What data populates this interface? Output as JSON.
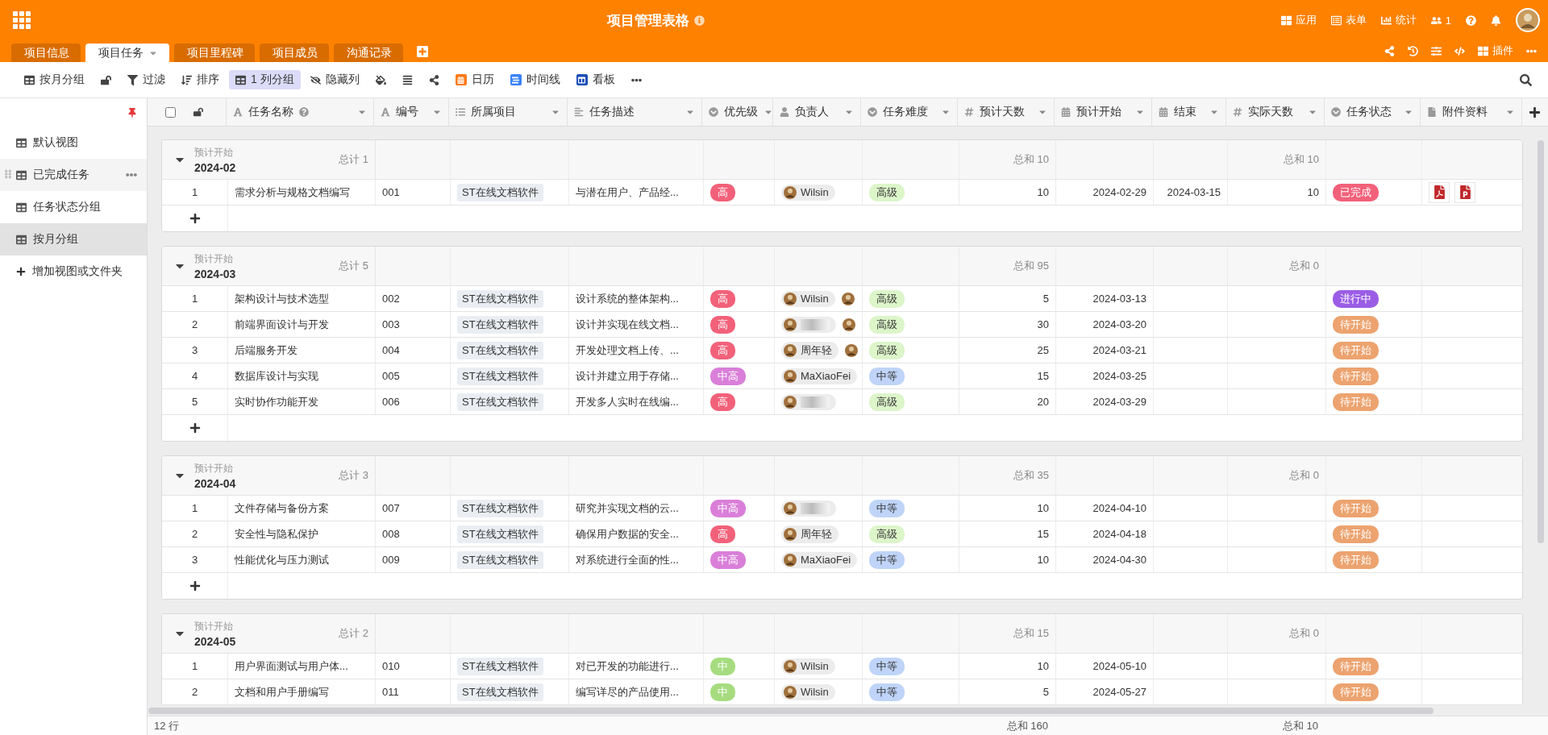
{
  "app": {
    "title": "项目管理表格"
  },
  "top_actions": [
    {
      "kind": "apps",
      "label": "应用"
    },
    {
      "kind": "form",
      "label": "表单"
    },
    {
      "kind": "stats",
      "label": "统计"
    },
    {
      "kind": "collaborators",
      "label": "1"
    },
    {
      "kind": "help"
    },
    {
      "kind": "notifications"
    },
    {
      "kind": "avatar"
    }
  ],
  "tabs": [
    {
      "label": "项目信息",
      "selected": false
    },
    {
      "label": "项目任务",
      "selected": true
    },
    {
      "label": "项目里程碑",
      "selected": false
    },
    {
      "label": "项目成员",
      "selected": false
    },
    {
      "label": "沟通记录",
      "selected": false
    }
  ],
  "tab_actions": [
    {
      "kind": "share"
    },
    {
      "kind": "history"
    },
    {
      "kind": "settings"
    },
    {
      "kind": "code"
    },
    {
      "kind": "plugins",
      "label": "插件"
    },
    {
      "kind": "more"
    }
  ],
  "toolbar": [
    {
      "kind": "view",
      "label": "按月分组",
      "active": false
    },
    {
      "kind": "lock",
      "active": false
    },
    {
      "kind": "filter",
      "label": "过滤",
      "active": false
    },
    {
      "kind": "sort",
      "label": "排序",
      "active": false
    },
    {
      "kind": "group",
      "label": "1 列分组",
      "active": true
    },
    {
      "kind": "hide",
      "label": "隐藏列",
      "active": false
    },
    {
      "kind": "fill",
      "active": false
    },
    {
      "kind": "row-height",
      "active": false
    },
    {
      "kind": "share",
      "active": false
    },
    {
      "kind": "calendar",
      "label": "日历",
      "active": false
    },
    {
      "kind": "timeline",
      "label": "时间线",
      "active": false
    },
    {
      "kind": "kanban",
      "label": "看板",
      "active": false
    },
    {
      "kind": "more",
      "active": false
    }
  ],
  "sidebar": {
    "items": [
      {
        "label": "默认视图",
        "selected": false,
        "hovered": false
      },
      {
        "label": "已完成任务",
        "selected": false,
        "hovered": true
      },
      {
        "label": "任务状态分组",
        "selected": false,
        "hovered": false
      },
      {
        "label": "按月分组",
        "selected": true,
        "hovered": false
      }
    ],
    "add_label": "增加视图或文件夹"
  },
  "table": {
    "select_all": {
      "checked": false
    },
    "columns": [
      {
        "label": "任务名称",
        "kind": "text",
        "help": true
      },
      {
        "label": "编号",
        "kind": "text",
        "help": false
      },
      {
        "label": "所属项目",
        "kind": "link",
        "help": false
      },
      {
        "label": "任务描述",
        "kind": "long-text",
        "help": false
      },
      {
        "label": "优先级",
        "kind": "single-select",
        "help": false
      },
      {
        "label": "负责人",
        "kind": "collaborator",
        "help": false
      },
      {
        "label": "任务难度",
        "kind": "single-select",
        "help": false
      },
      {
        "label": "预计天数",
        "kind": "number",
        "help": false
      },
      {
        "label": "预计开始",
        "kind": "date",
        "help": false
      },
      {
        "label": "结束",
        "kind": "date",
        "help": false
      },
      {
        "label": "实际天数",
        "kind": "number",
        "help": false
      },
      {
        "label": "任务状态",
        "kind": "single-select",
        "help": false
      },
      {
        "label": "附件资料",
        "kind": "file",
        "help": false
      }
    ],
    "groups": [
      {
        "field_label": "预计开始",
        "value": "2024-02",
        "count": "总计 1",
        "planned_days_sum": "总和 10",
        "actual_days_sum": "总和 10",
        "expanded": true,
        "rows": [
          {
            "num": "1",
            "name": "需求分析与规格文档编写",
            "code": "001",
            "project": "ST在线文档软件",
            "description": "与潜在用户、产品经...",
            "priority": {
              "label": "高",
              "color": "#f2617a"
            },
            "owners": [
              {
                "kind": "person",
                "name": "Wilsin"
              }
            ],
            "difficulty": {
              "label": "高级",
              "color": "#dcf5c9"
            },
            "planned_days": "10",
            "start": "2024-02-29",
            "end": "2024-03-15",
            "actual_days": "10",
            "status": {
              "label": "已完成",
              "color": "#f2617a"
            },
            "attachments": [
              {
                "kind": "pdf"
              },
              {
                "kind": "ppt"
              }
            ]
          }
        ]
      },
      {
        "field_label": "预计开始",
        "value": "2024-03",
        "count": "总计 5",
        "planned_days_sum": "总和 95",
        "actual_days_sum": "总和 0",
        "expanded": true,
        "rows": [
          {
            "num": "1",
            "name": "架构设计与技术选型",
            "code": "002",
            "project": "ST在线文档软件",
            "description": "设计系统的整体架构...",
            "priority": {
              "label": "高",
              "color": "#f2617a"
            },
            "owners": [
              {
                "kind": "person",
                "name": "Wilsin"
              },
              {
                "kind": "avatar"
              }
            ],
            "difficulty": {
              "label": "高级",
              "color": "#dcf5c9"
            },
            "planned_days": "5",
            "start": "2024-03-13",
            "status": {
              "label": "进行中",
              "color": "#9b5de5"
            }
          },
          {
            "num": "2",
            "name": "前端界面设计与开发",
            "code": "003",
            "project": "ST在线文档软件",
            "description": "设计并实现在线文档...",
            "priority": {
              "label": "高",
              "color": "#f2617a"
            },
            "owners": [
              {
                "kind": "masked"
              },
              {
                "kind": "avatar"
              }
            ],
            "difficulty": {
              "label": "高级",
              "color": "#dcf5c9"
            },
            "planned_days": "30",
            "start": "2024-03-20",
            "status": {
              "label": "待开始",
              "color": "#eca36f"
            }
          },
          {
            "num": "3",
            "name": "后端服务开发",
            "code": "004",
            "project": "ST在线文档软件",
            "description": "开发处理文档上传、...",
            "priority": {
              "label": "高",
              "color": "#f2617a"
            },
            "owners": [
              {
                "kind": "person",
                "name": "周年轻"
              },
              {
                "kind": "avatar"
              }
            ],
            "difficulty": {
              "label": "高级",
              "color": "#dcf5c9"
            },
            "planned_days": "25",
            "start": "2024-03-21",
            "status": {
              "label": "待开始",
              "color": "#eca36f"
            }
          },
          {
            "num": "4",
            "name": "数据库设计与实现",
            "code": "005",
            "project": "ST在线文档软件",
            "description": "设计并建立用于存储...",
            "priority": {
              "label": "中高",
              "color": "#da7fd9"
            },
            "owners": [
              {
                "kind": "person",
                "name": "MaXiaoFei"
              }
            ],
            "difficulty": {
              "label": "中等",
              "color": "#bfd4f8"
            },
            "planned_days": "15",
            "start": "2024-03-25",
            "status": {
              "label": "待开始",
              "color": "#eca36f"
            }
          },
          {
            "num": "5",
            "name": "实时协作功能开发",
            "code": "006",
            "project": "ST在线文档软件",
            "description": "开发多人实时在线编...",
            "priority": {
              "label": "高",
              "color": "#f2617a"
            },
            "owners": [
              {
                "kind": "masked"
              }
            ],
            "difficulty": {
              "label": "高级",
              "color": "#dcf5c9"
            },
            "planned_days": "20",
            "start": "2024-03-29",
            "status": {
              "label": "待开始",
              "color": "#eca36f"
            }
          }
        ]
      },
      {
        "field_label": "预计开始",
        "value": "2024-04",
        "count": "总计 3",
        "planned_days_sum": "总和 35",
        "actual_days_sum": "总和 0",
        "expanded": true,
        "rows": [
          {
            "num": "1",
            "name": "文件存储与备份方案",
            "code": "007",
            "project": "ST在线文档软件",
            "description": "研究并实现文档的云...",
            "priority": {
              "label": "中高",
              "color": "#da7fd9"
            },
            "owners": [
              {
                "kind": "masked"
              }
            ],
            "difficulty": {
              "label": "中等",
              "color": "#bfd4f8"
            },
            "planned_days": "10",
            "start": "2024-04-10",
            "status": {
              "label": "待开始",
              "color": "#eca36f"
            }
          },
          {
            "num": "2",
            "name": "安全性与隐私保护",
            "code": "008",
            "project": "ST在线文档软件",
            "description": "确保用户数据的安全...",
            "priority": {
              "label": "高",
              "color": "#f2617a"
            },
            "owners": [
              {
                "kind": "person",
                "name": "周年轻"
              }
            ],
            "difficulty": {
              "label": "高级",
              "color": "#dcf5c9"
            },
            "planned_days": "15",
            "start": "2024-04-18",
            "status": {
              "label": "待开始",
              "color": "#eca36f"
            }
          },
          {
            "num": "3",
            "name": "性能优化与压力测试",
            "code": "009",
            "project": "ST在线文档软件",
            "description": "对系统进行全面的性...",
            "priority": {
              "label": "中高",
              "color": "#da7fd9"
            },
            "owners": [
              {
                "kind": "person",
                "name": "MaXiaoFei"
              }
            ],
            "difficulty": {
              "label": "中等",
              "color": "#bfd4f8"
            },
            "planned_days": "10",
            "start": "2024-04-30",
            "status": {
              "label": "待开始",
              "color": "#eca36f"
            }
          }
        ]
      },
      {
        "field_label": "预计开始",
        "value": "2024-05",
        "count": "总计 2",
        "planned_days_sum": "总和 15",
        "actual_days_sum": "总和 0",
        "expanded": true,
        "rows": [
          {
            "num": "1",
            "name": "用户界面测试与用户体...",
            "code": "010",
            "project": "ST在线文档软件",
            "description": "对已开发的功能进行...",
            "priority": {
              "label": "中",
              "color": "#a6dc7f"
            },
            "owners": [
              {
                "kind": "person",
                "name": "Wilsin"
              }
            ],
            "difficulty": {
              "label": "中等",
              "color": "#bfd4f8"
            },
            "planned_days": "10",
            "start": "2024-05-10",
            "status": {
              "label": "待开始",
              "color": "#eca36f"
            }
          },
          {
            "num": "2",
            "name": "文档和用户手册编写",
            "code": "011",
            "project": "ST在线文档软件",
            "description": "编写详尽的产品使用...",
            "priority": {
              "label": "中",
              "color": "#a6dc7f"
            },
            "owners": [
              {
                "kind": "person",
                "name": "Wilsin"
              }
            ],
            "difficulty": {
              "label": "中等",
              "color": "#bfd4f8"
            },
            "planned_days": "5",
            "start": "2024-05-27",
            "status": {
              "label": "待开始",
              "color": "#eca36f"
            }
          }
        ]
      }
    ]
  },
  "footer": {
    "row_count": "12 行",
    "planned_days_sum": "总和 160",
    "actual_days_sum": "总和 10"
  }
}
